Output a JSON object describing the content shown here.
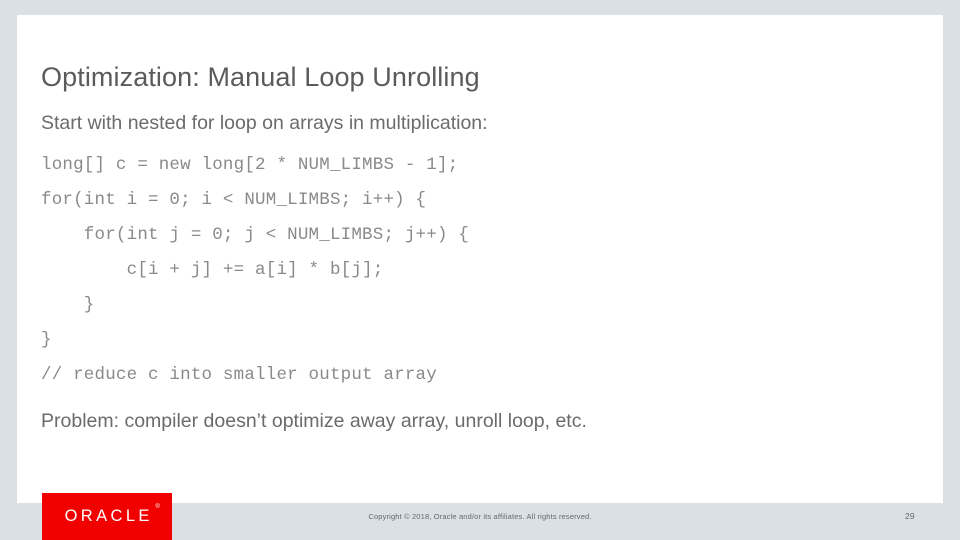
{
  "slide": {
    "title": "Optimization: Manual Loop Unrolling",
    "intro": "Start with nested for loop on arrays in multiplication:",
    "code_lines": [
      "long[] c = new long[2 * NUM_LIMBS - 1];",
      "for(int i = 0; i < NUM_LIMBS; i++) {",
      "    for(int j = 0; j < NUM_LIMBS; j++) {",
      "        c[i + j] += a[i] * b[j];",
      "    }",
      "}",
      "// reduce c into smaller output array"
    ],
    "problem": "Problem: compiler doesn’t optimize away array, unroll loop, etc."
  },
  "footer": {
    "logo_text": "ORACLE",
    "logo_trademark": "®",
    "copyright": "Copyright © 2018, Oracle and/or its affiliates. All rights reserved.",
    "slide_number": "29"
  },
  "colors": {
    "background": "#dbe0e5",
    "slide": "#ffffff",
    "title_text": "#5b5b5b",
    "body_text": "#6b6b6b",
    "code_text": "#8a8a8a",
    "logo_red": "#f20000",
    "footer_text": "#5e6a72"
  }
}
